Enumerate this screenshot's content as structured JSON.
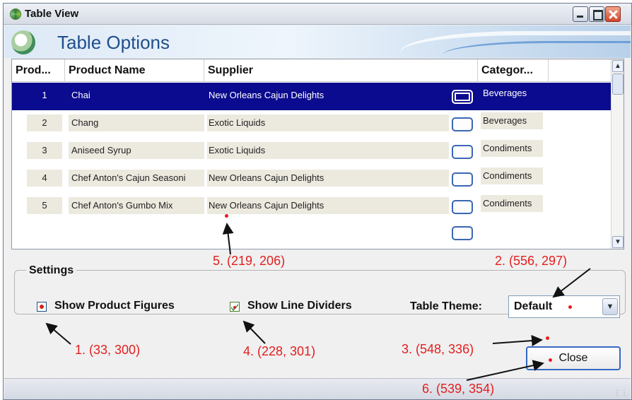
{
  "window": {
    "title": "Table View",
    "banner_title": "Table Options"
  },
  "table": {
    "columns": [
      "Prod...",
      "Product Name",
      "Supplier",
      "Categor..."
    ],
    "rows": [
      {
        "id": "1",
        "name": "Chai",
        "supplier": "New Orleans Cajun Delights",
        "category": "Beverages",
        "selected": true
      },
      {
        "id": "2",
        "name": "Chang",
        "supplier": "Exotic Liquids",
        "category": "Beverages",
        "selected": false
      },
      {
        "id": "3",
        "name": "Aniseed Syrup",
        "supplier": "Exotic Liquids",
        "category": "Condiments",
        "selected": false
      },
      {
        "id": "4",
        "name": "Chef Anton's Cajun Seasoni",
        "supplier": "New Orleans Cajun Delights",
        "category": "Condiments",
        "selected": false
      },
      {
        "id": "5",
        "name": "Chef Anton's Gumbo Mix",
        "supplier": "New Orleans Cajun Delights",
        "category": "Condiments",
        "selected": false
      }
    ]
  },
  "settings": {
    "legend": "Settings",
    "show_product_figures": {
      "label": "Show Product Figures",
      "checked": true
    },
    "show_line_dividers": {
      "label": "Show Line Dividers",
      "checked": true
    },
    "table_theme_label": "Table Theme:",
    "table_theme_value": "Default"
  },
  "buttons": {
    "close": "Close"
  },
  "annotations": [
    {
      "id": "1",
      "text": "1. (33, 300)"
    },
    {
      "id": "2",
      "text": "2. (556, 297)"
    },
    {
      "id": "3",
      "text": "3. (548, 336)"
    },
    {
      "id": "4",
      "text": "4. (228, 301)"
    },
    {
      "id": "5",
      "text": "5. (219, 206)"
    },
    {
      "id": "6",
      "text": "6. (539, 354)"
    }
  ],
  "colors": {
    "selection": "#0b0b8f",
    "annotation": "#e31e1e",
    "banner_title": "#1f4e8c"
  }
}
